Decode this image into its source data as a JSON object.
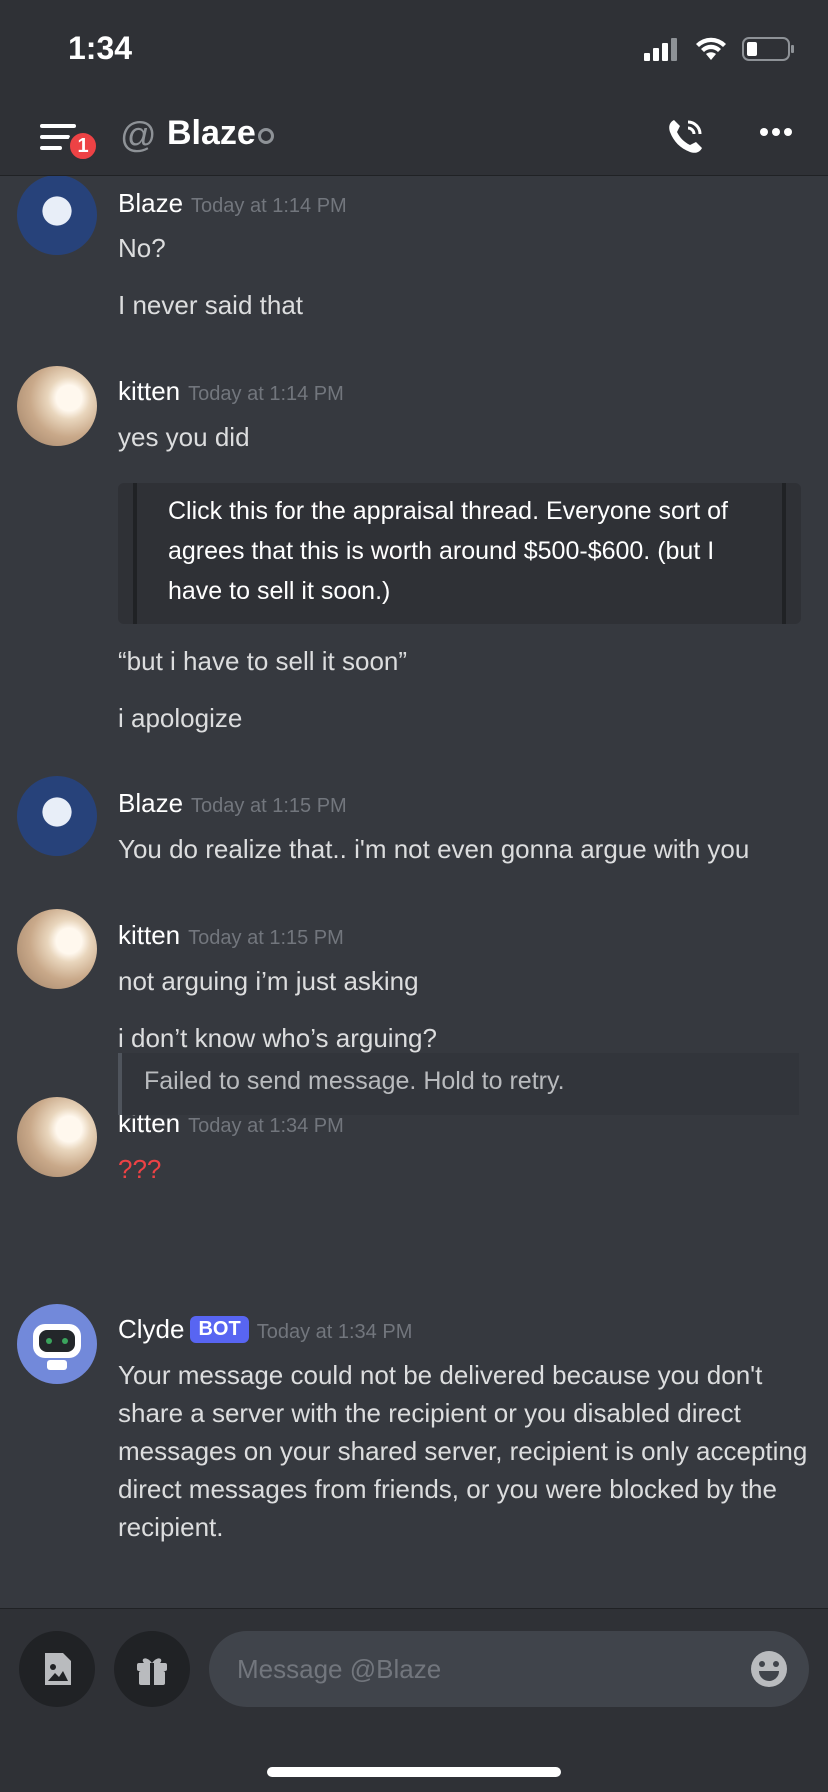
{
  "status_bar": {
    "time": "1:34"
  },
  "header": {
    "notification_count": "1",
    "at": "@",
    "title": "Blaze"
  },
  "messages": [
    {
      "author": "Blaze",
      "timestamp": "Today at 1:14 PM",
      "lines": [
        "No?",
        "I never said that"
      ]
    },
    {
      "author": "kitten",
      "timestamp": "Today at 1:14 PM",
      "lines": [
        "yes you did"
      ],
      "embed": "Click this for the appraisal thread. Everyone sort of agrees that this is worth around $500-$600. (but I have to sell it soon.)",
      "after_embed": [
        "“but i have to sell it soon”",
        "i apologize"
      ]
    },
    {
      "author": "Blaze",
      "timestamp": "Today at 1:15 PM",
      "lines": [
        "You do realize that.. i'm not even gonna argue with you"
      ]
    },
    {
      "author": "kitten",
      "timestamp": "Today at 1:15 PM",
      "lines": [
        "not arguing i’m just asking",
        "i don’t know who’s arguing?"
      ]
    },
    {
      "author": "kitten",
      "timestamp": "Today at 1:34 PM",
      "lines": [
        "???"
      ],
      "failed_notice": "Failed to send message. Hold to retry."
    },
    {
      "author": "Clyde",
      "bot_tag": "BOT",
      "timestamp": "Today at 1:34 PM",
      "text": "Your message could not be delivered because you don't share a server with the recipient or you disabled direct messages on your shared server, recipient is only accepting direct messages from friends, or you were blocked by the recipient."
    }
  ],
  "composer": {
    "placeholder": "Message @Blaze"
  },
  "colors": {
    "background": "#36393f",
    "header": "#2f3136",
    "failed_text": "#ed4245",
    "bot_tag": "#5865f2",
    "badge": "#ed4245"
  }
}
